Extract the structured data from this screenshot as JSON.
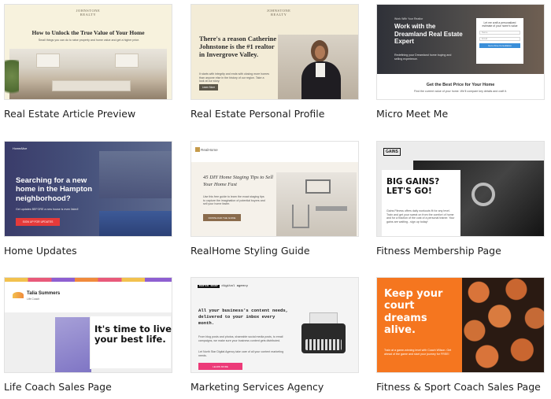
{
  "cards": [
    {
      "title": "Real Estate Article Preview",
      "thumb": {
        "logo": "JOHNSTONE\nREALTY",
        "headline": "How to Unlock the True Value of Your Home",
        "sub": "Small things you can do to raise property and home value and get a higher price."
      }
    },
    {
      "title": "Real Estate Personal Profile",
      "thumb": {
        "logo": "JOHNSTONE\nREALTY",
        "headline": "There's a reason Catherine Johnstone is the #1 realtor in Invergrove Valley.",
        "sub": "It starts with integrity and ends with closing more homes than anyone else in the history of our region. Take a look at our story.",
        "button": "Learn More"
      }
    },
    {
      "title": "Micro Meet Me",
      "thumb": {
        "eyebrow": "Work With Your Realtor",
        "headline": "Work with the Dreamland Real Estate Expert",
        "sub": "Redefining your Dreamland home buying and selling experience.",
        "form_title": "Let me craft a personalized estimate of your home's value",
        "field_name": "Name",
        "field_email": "Email",
        "form_button": "Get a Free Consultation",
        "cta": "Get the Best Price for Your Home",
        "cta_sub": "Find the current value of your home. We'll compare key details and craft it."
      }
    },
    {
      "title": "Home Updates",
      "thumb": {
        "logo": "HomeAlive",
        "headline": "Searching for a new home in the Hampton neighborhood?",
        "sub": "Get updates BEFORE a new house is even listed!",
        "button": "SIGN UP FOR UPDATES"
      }
    },
    {
      "title": "RealHome Styling Guide",
      "thumb": {
        "logo": "RealHome",
        "headline": "45 DIY Home Staging Tips to Sell Your Home Fast",
        "sub": "Use this free guide to learn the exact staging tips to capture the imagination of potential buyers and sell your home faster.",
        "button": "DOWNLOAD THE GUIDE"
      }
    },
    {
      "title": "Fitness Membership Page",
      "thumb": {
        "logo": "GAINS",
        "headline": "BIG GAINS? LET'S GO!",
        "sub": "Gains Fitness offers daily workouts fit for any level. Train and get your sweat on from the comfort of home and for a fraction of the cost of a personal trainer. Your gains are waiting - sign up today!"
      }
    },
    {
      "title": "Life Coach Sales Page",
      "thumb": {
        "name": "Talia Summers",
        "role": "Life Coach",
        "headline": "It's time to live your best life."
      }
    },
    {
      "title": "Marketing Services Agency",
      "thumb": {
        "logo_bold": "north star",
        "logo_rest": "digital agency",
        "headline": "All your business's content needs, delivered to your inbox every month.",
        "sub": "From blog posts and photos, shareable social media posts, to email campaigns, we make sure your business content gets distributed.",
        "sub2": "Let North Star Digital Agency take care of all your content marketing needs.",
        "button": "LEARN MORE"
      }
    },
    {
      "title": "Fitness & Sport Coach Sales Page",
      "thumb": {
        "headline": "Keep your court dreams alive.",
        "sub": "Train at a game-winning level with Coach Wilson. Get ahead of the game and start your journey for FREE!"
      }
    }
  ]
}
